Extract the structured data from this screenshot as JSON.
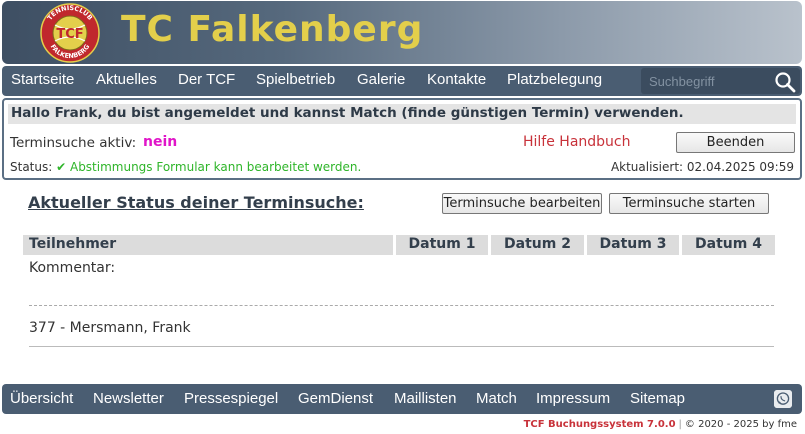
{
  "header": {
    "title": "TC Falkenberg",
    "logo": {
      "top_text": "TENNISCLUB",
      "center_text": "TCF",
      "bottom_text": "FALKENBERG",
      "color_ring": "#c0282d",
      "color_inner": "#e3cf4b"
    }
  },
  "nav": {
    "items": [
      "Startseite",
      "Aktuelles",
      "Der TCF",
      "Spielbetrieb",
      "Galerie",
      "Kontakte",
      "Platzbelegung"
    ],
    "search": {
      "placeholder": "Suchbegriff",
      "value": ""
    }
  },
  "panel": {
    "greeting": "Hallo Frank, du bist angemeldet und kannst Match (finde günstigen Termin) verwenden.",
    "ts_label": "Terminsuche aktiv:",
    "ts_value": "nein",
    "help_label": "Hilfe Handbuch",
    "end_button": "Beenden",
    "status_prefix": "Status:",
    "status_text": "✔ Abstimmungs Formular kann bearbeitet werden.",
    "updated": "Aktualisiert: 02.04.2025 09:59"
  },
  "main": {
    "heading": "Aktueller Status deiner Terminsuche:",
    "edit_button": "Terminsuche bearbeiten",
    "start_button": "Terminsuche starten",
    "columns": [
      "Teilnehmer",
      "Datum 1",
      "Datum 2",
      "Datum 3",
      "Datum 4"
    ],
    "comment_label": "Kommentar:",
    "participant": "377 - Mersmann, Frank"
  },
  "footer": {
    "items": [
      "Übersicht",
      "Newsletter",
      "Pressespiegel",
      "GemDienst",
      "Maillisten",
      "Match",
      "Impressum",
      "Sitemap"
    ],
    "whatsapp_icon": "whatsapp-icon",
    "brand": "TCF Buchungssystem 7.0.0",
    "separator": "|",
    "copyright": "© 2020 - 2025 by fme"
  },
  "colors": {
    "nav_bg": "#4a5d72",
    "title": "#e3cf4b",
    "nein": "#e015c8",
    "ok": "#2fb52a",
    "help": "#c8323a"
  }
}
